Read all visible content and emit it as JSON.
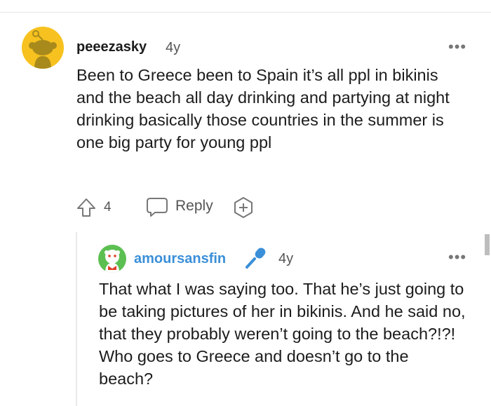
{
  "comments": [
    {
      "author": "peeezasky",
      "age": "4y",
      "body": "Been to Greece been to Spain it’s all ppl in bikinis and the beach all day drinking and partying at night drinking basically those countries in the summer is one big party for young ppl",
      "score": "4",
      "reply_label": "Reply",
      "more_label": "•••"
    },
    {
      "author": "amoursansfin",
      "age": "4y",
      "body": "That what I was saying too. That he’s just going to be taking pictures of her in bikinis. And he said no, that they probably weren’t going to the beach?!?! Who goes to Greece and doesn’t go to the beach?",
      "more_label": "•••"
    }
  ],
  "icons": {
    "upvote": "arrow-up-outline",
    "reply": "speech-bubble",
    "award": "plus-circle",
    "flair": "microphone",
    "more": "horizontal-ellipsis"
  },
  "colors": {
    "avatar_main_bg": "#f7c21f",
    "avatar_reply_bg": "#5cbf52",
    "reply_author": "#3a8fd8",
    "flair_icon": "#3a8fd8"
  }
}
